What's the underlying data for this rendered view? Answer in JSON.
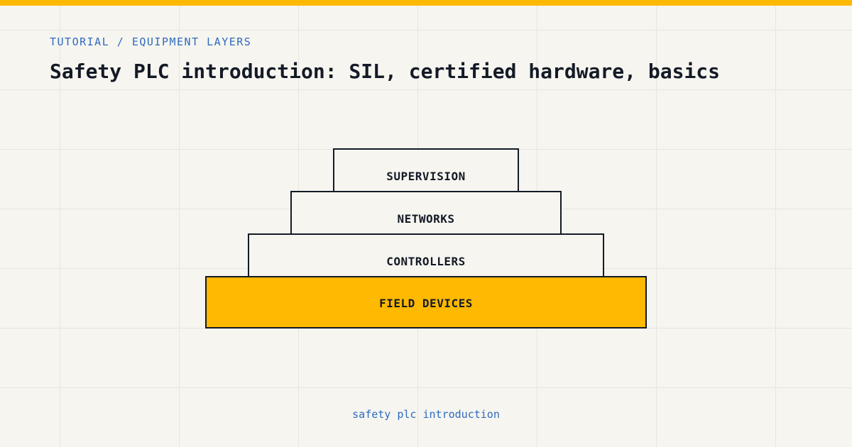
{
  "header": {
    "breadcrumb": "TUTORIAL / EQUIPMENT LAYERS",
    "title": "Safety PLC introduction: SIL, certified hardware, basics"
  },
  "diagram": {
    "layers": [
      {
        "label": "SUPERVISION"
      },
      {
        "label": "NETWORKS"
      },
      {
        "label": "CONTROLLERS"
      },
      {
        "label": "FIELD DEVICES",
        "highlighted": true
      }
    ]
  },
  "footer": {
    "caption": "safety plc introduction"
  },
  "colors": {
    "accent": "#ffb900",
    "link": "#2f6bbf",
    "ink": "#141a26",
    "background": "#f6f5f0"
  }
}
